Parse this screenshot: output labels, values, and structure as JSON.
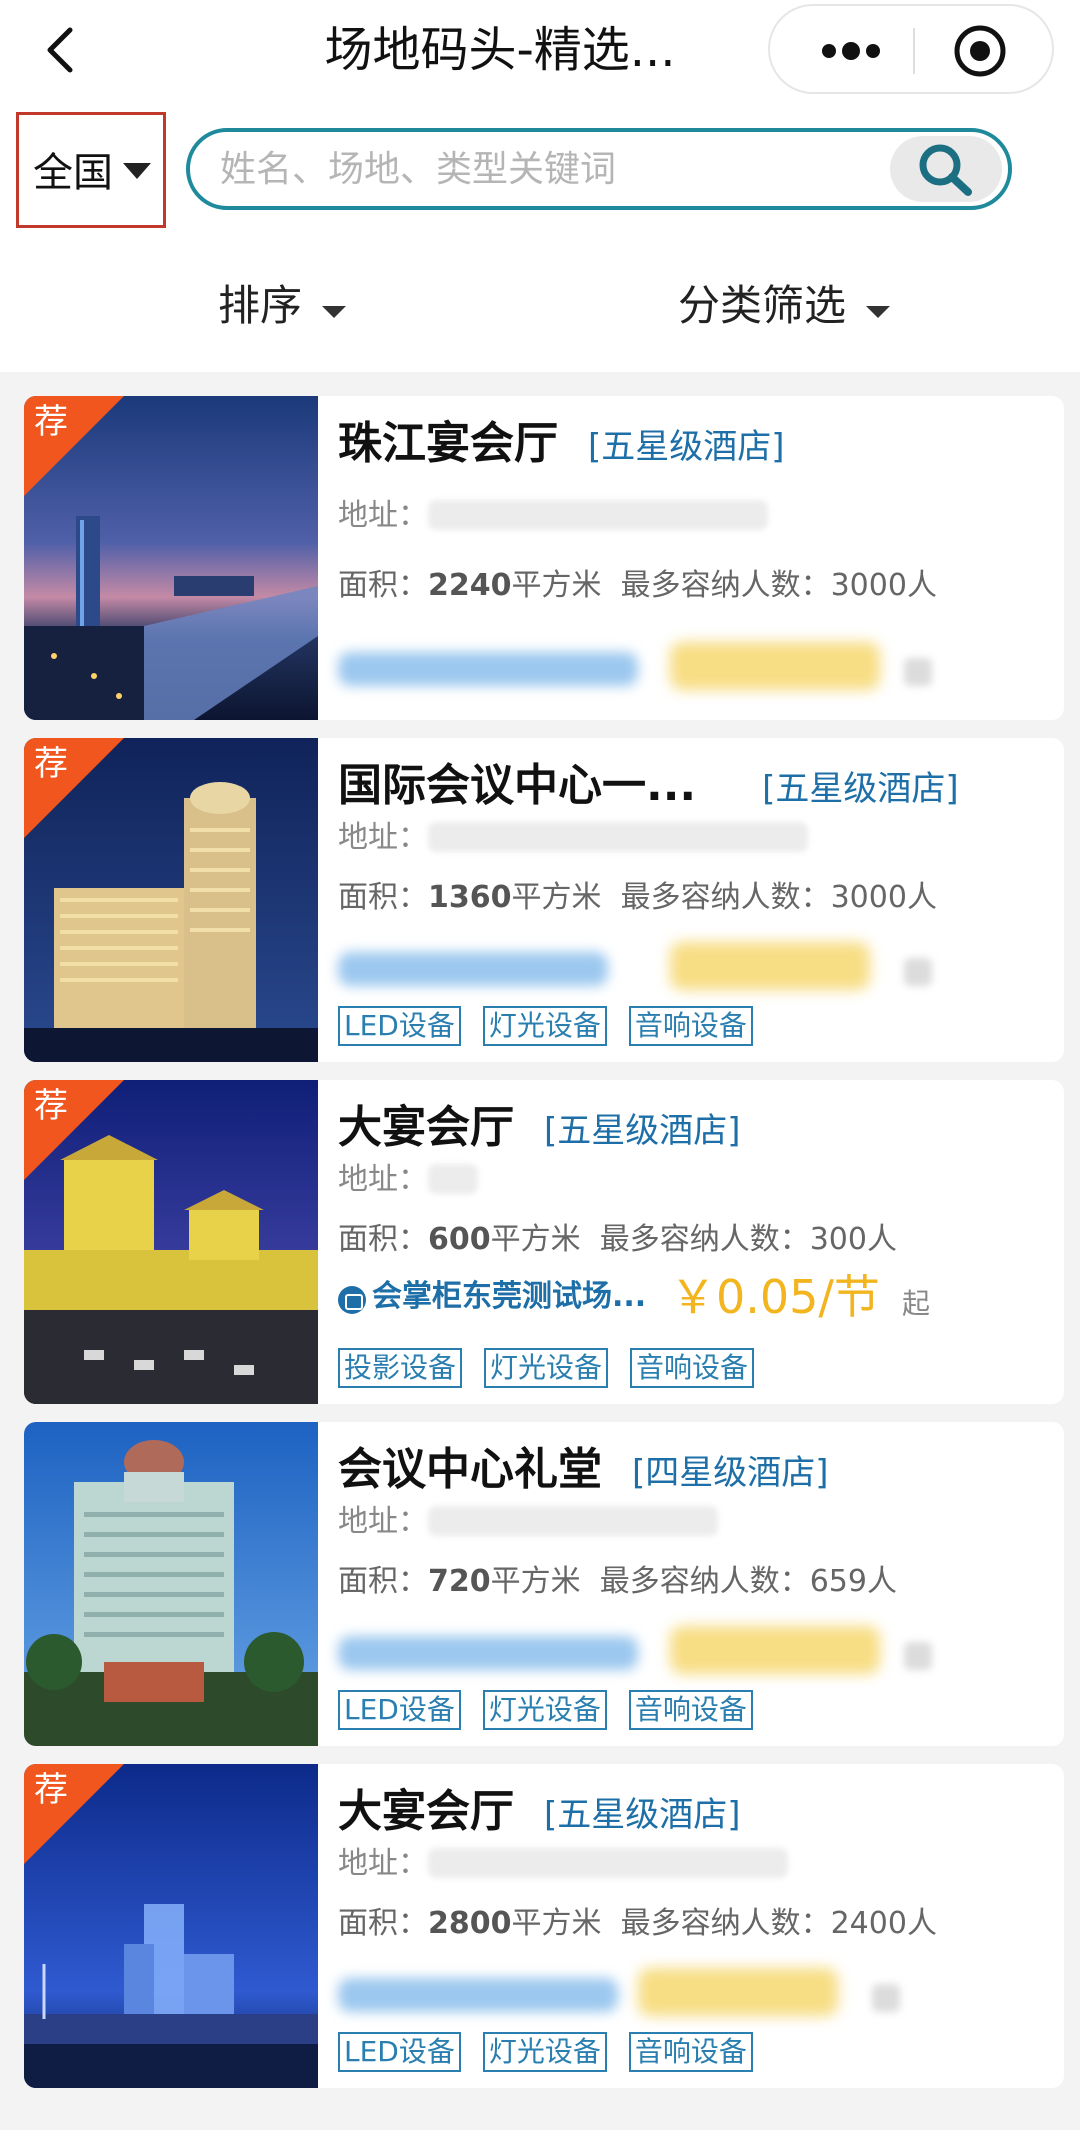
{
  "header": {
    "title": "场地码头-精选...",
    "back_icon": "chevron-left-icon",
    "more_icon": "more-dots-icon",
    "target_icon": "target-circle-icon"
  },
  "search": {
    "region": "全国",
    "placeholder": "姓名、场地、类型关键词",
    "value": ""
  },
  "filters": {
    "sort_label": "排序",
    "category_label": "分类筛选"
  },
  "labels": {
    "address": "地址：",
    "area": "面积：",
    "area_unit": "平方米",
    "capacity": "最多容纳人数：",
    "capacity_unit": "人",
    "recommended": "荐"
  },
  "venues": [
    {
      "name": "珠江宴会厅",
      "category": "[五星级酒店]",
      "recommended": true,
      "area": "2240",
      "capacity": "3000",
      "equipment": []
    },
    {
      "name": "国际会议中心一...",
      "category": "[五星级酒店]",
      "recommended": true,
      "area": "1360",
      "capacity": "3000",
      "equipment": [
        "LED设备",
        "灯光设备",
        "音响设备"
      ]
    },
    {
      "name": "大宴会厅",
      "category": "[五星级酒店]",
      "recommended": true,
      "area": "600",
      "capacity": "300",
      "organizer": "会掌柜东莞测试场...",
      "price": "￥0.05/节",
      "price_suffix": "起",
      "equipment": [
        "投影设备",
        "灯光设备",
        "音响设备"
      ]
    },
    {
      "name": "会议中心礼堂",
      "category": "[四星级酒店]",
      "recommended": false,
      "area": "720",
      "capacity": "659",
      "equipment": [
        "LED设备",
        "灯光设备",
        "音响设备"
      ]
    },
    {
      "name": "大宴会厅",
      "category": "[五星级酒店]",
      "recommended": true,
      "area": "2800",
      "capacity": "2400",
      "equipment": [
        "LED设备",
        "灯光设备",
        "音响设备"
      ]
    }
  ],
  "colors": {
    "accent": "#1e8a9c",
    "tag_blue": "#1e6fa8",
    "price": "#f2b51f",
    "badge": "#f0561e",
    "region_border": "#c0392b"
  }
}
